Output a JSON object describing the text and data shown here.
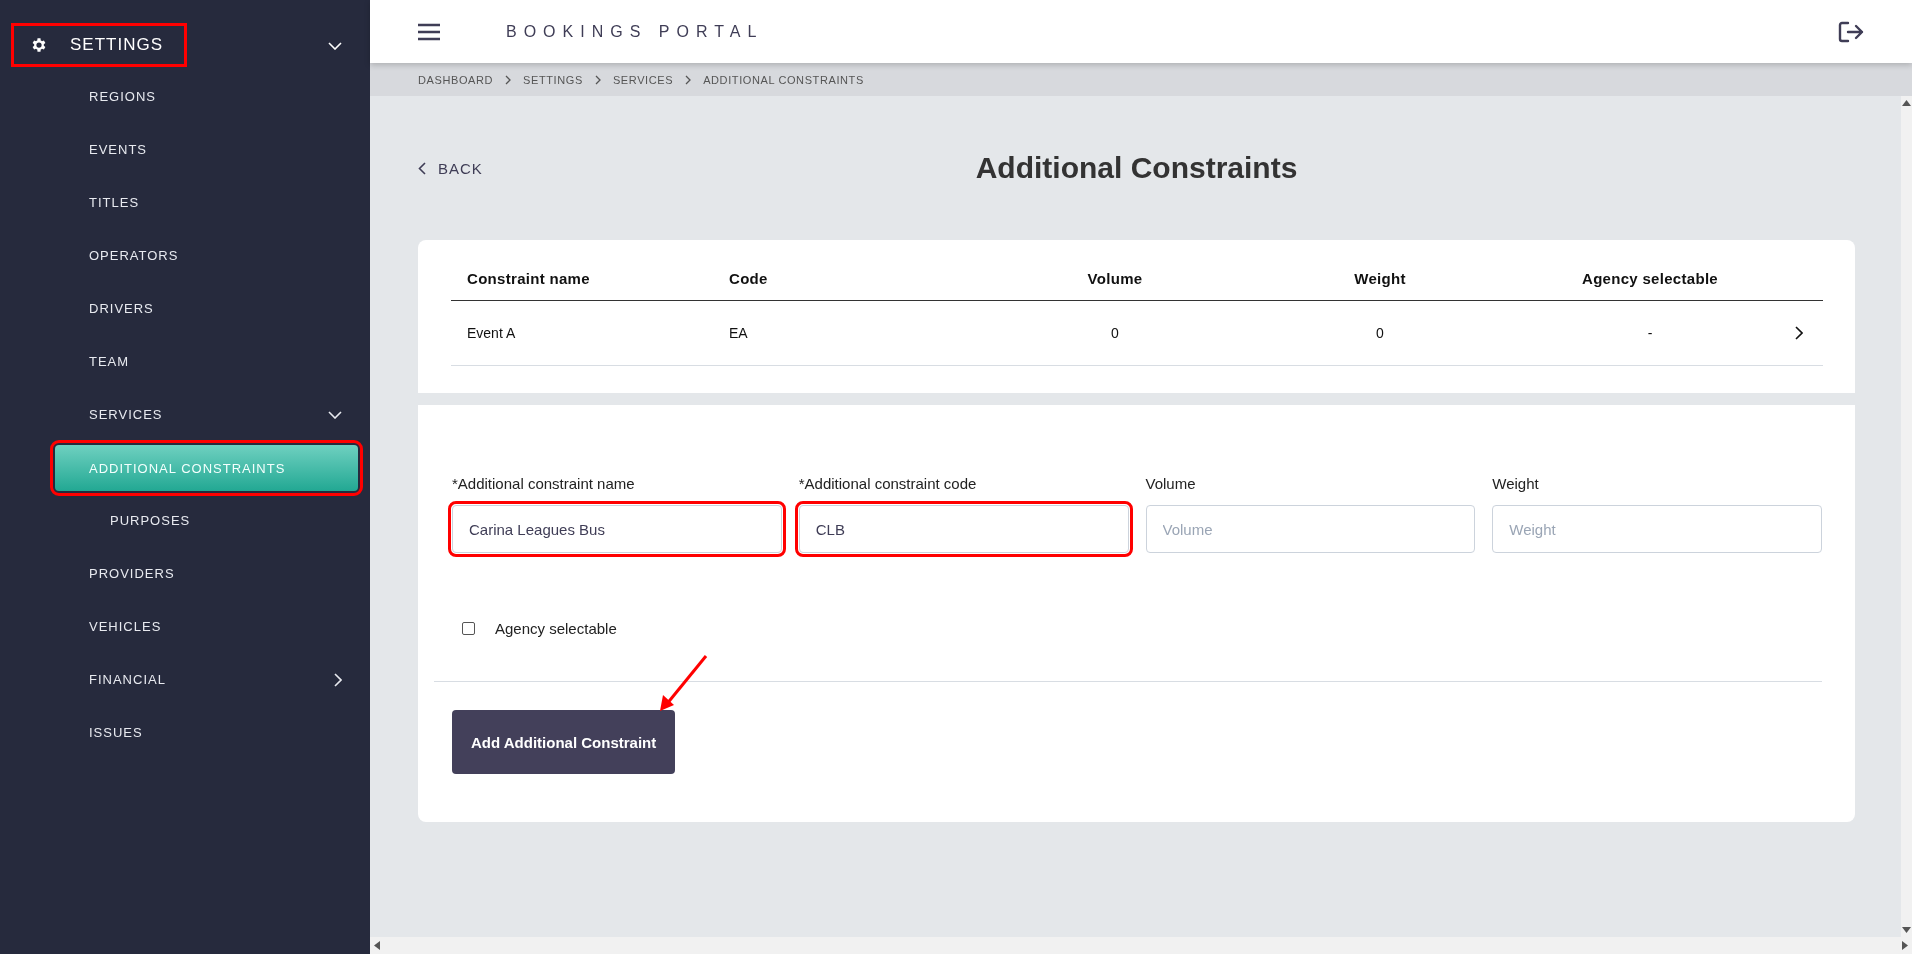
{
  "sidebar": {
    "section": {
      "label": "SETTINGS",
      "expanded": true,
      "highlighted": true
    },
    "items": [
      {
        "kind": "link",
        "label": "REGIONS",
        "selected": false,
        "highlighted": false
      },
      {
        "kind": "link",
        "label": "EVENTS",
        "selected": false,
        "highlighted": false
      },
      {
        "kind": "link",
        "label": "TITLES",
        "selected": false,
        "highlighted": false
      },
      {
        "kind": "link",
        "label": "OPERATORS",
        "selected": false,
        "highlighted": false
      },
      {
        "kind": "link",
        "label": "DRIVERS",
        "selected": false,
        "highlighted": false
      },
      {
        "kind": "link",
        "label": "TEAM",
        "selected": false,
        "highlighted": false
      },
      {
        "kind": "group",
        "label": "SERVICES",
        "selected": false,
        "highlighted": false,
        "expanded": true,
        "children": [
          {
            "label": "ADDITIONAL CONSTRAINTS",
            "selected": true,
            "highlighted": true
          },
          {
            "label": "PURPOSES",
            "selected": false,
            "highlighted": false
          }
        ]
      },
      {
        "kind": "link",
        "label": "PROVIDERS",
        "selected": false,
        "highlighted": false
      },
      {
        "kind": "link",
        "label": "VEHICLES",
        "selected": false,
        "highlighted": false
      },
      {
        "kind": "group",
        "label": "FINANCIAL",
        "selected": false,
        "highlighted": false,
        "expanded": false
      },
      {
        "kind": "link",
        "label": "ISSUES",
        "selected": false,
        "highlighted": false
      }
    ]
  },
  "header": {
    "title": "BOOKINGS PORTAL"
  },
  "breadcrumbs": [
    "DASHBOARD",
    "SETTINGS",
    "SERVICES",
    "ADDITIONAL CONSTRAINTS"
  ],
  "page": {
    "back": "BACK",
    "title": "Additional Constraints"
  },
  "table": {
    "columns": [
      "Constraint name",
      "Code",
      "Volume",
      "Weight",
      "Agency selectable"
    ],
    "rows": [
      {
        "cells": [
          "Event A",
          "EA",
          "0",
          "0",
          "-"
        ]
      }
    ]
  },
  "form": {
    "fields": [
      {
        "label": "*Additional constraint name",
        "value": "Carina Leagues Bus",
        "highlighted": true
      },
      {
        "label": "*Additional constraint code",
        "value": "CLB",
        "highlighted": true
      },
      {
        "label": "Volume",
        "placeholder": "Volume",
        "highlighted": false
      },
      {
        "label": "Weight",
        "placeholder": "Weight",
        "highlighted": false
      }
    ],
    "checkbox": {
      "label": "Agency selectable",
      "checked": false
    },
    "submit": "Add Additional Constraint",
    "arrow_annotation": true
  }
}
